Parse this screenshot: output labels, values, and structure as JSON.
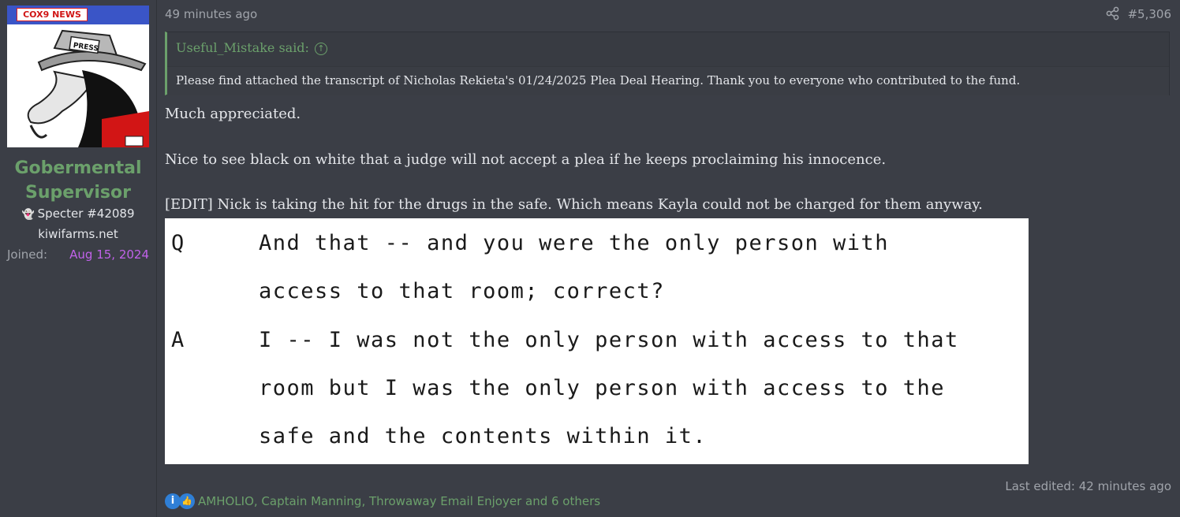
{
  "user": {
    "avatar_banner": "COX9 NEWS",
    "avatar_hat_text": "PRESS",
    "name_line1": "Gobermental",
    "name_line2": "Supervisor",
    "rank": "Specter #42089",
    "site": "kiwifarms.net",
    "joined_label": "Joined:",
    "joined_date": "Aug 15, 2024"
  },
  "post": {
    "time": "49 minutes ago",
    "number": "#5,306",
    "quote": {
      "author": "Useful_Mistake said:",
      "text": "Please find attached the transcript of Nicholas Rekieta's 01/24/2025 Plea Deal Hearing. Thank you to everyone who contributed to the fund."
    },
    "paragraphs": [
      "Much appreciated.",
      "Nice to see black on white that a judge will not accept a plea if he keeps proclaiming his innocence.",
      "[EDIT] Nick is taking the hit for the drugs in the safe. Which means Kayla could not be charged for them anyway."
    ],
    "transcript": {
      "q_label": "Q",
      "q_line1": "And that -- and you were the only person with",
      "q_line2": "access to that room; correct?",
      "a_label": "A",
      "a_line1": "I -- I was not the only person with access to that",
      "a_line2": "room but I was the only person with access to the",
      "a_line3": "safe and the contents within it."
    },
    "last_edited": "Last edited: 42 minutes ago",
    "reactions": "AMHOLIO, Captain Manning, Throwaway Email Enjoyer and 6 others"
  },
  "colors": {
    "background": "#3b3e46",
    "accent_green": "#6ba06b",
    "join_date_purple": "#c162ea",
    "muted_text": "#a0a4ab"
  },
  "icons": [
    "share-icon",
    "ghost-icon",
    "info-reaction-icon",
    "like-reaction-icon",
    "quote-arrow-icon"
  ]
}
